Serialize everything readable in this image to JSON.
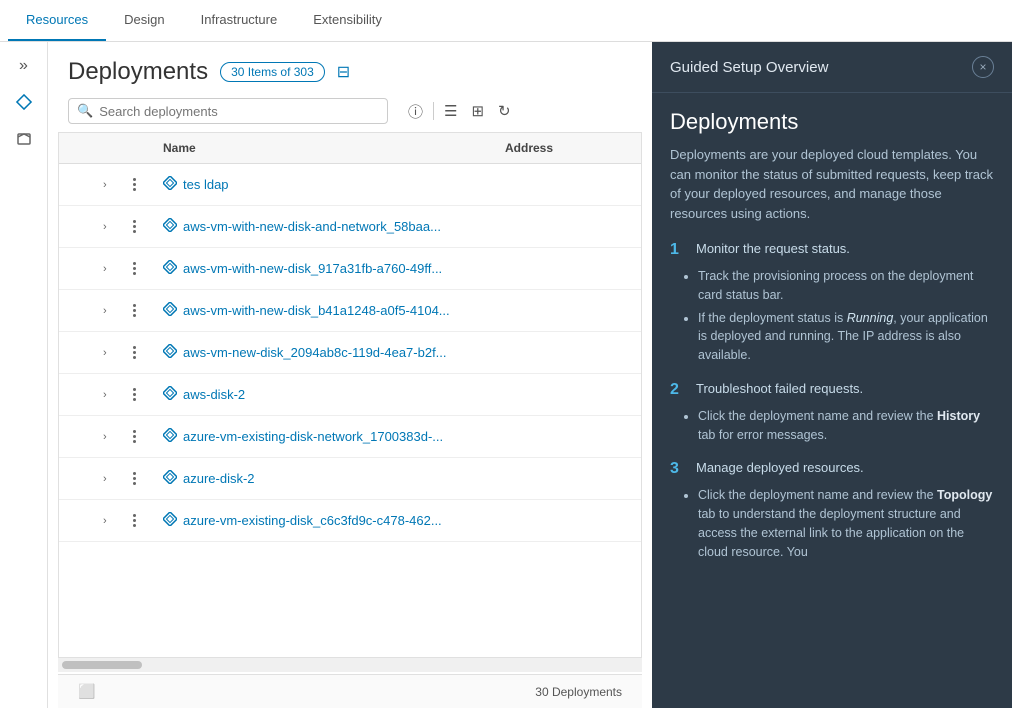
{
  "nav": {
    "tabs": [
      {
        "label": "Resources",
        "active": true
      },
      {
        "label": "Design",
        "active": false
      },
      {
        "label": "Infrastructure",
        "active": false
      },
      {
        "label": "Extensibility",
        "active": false
      }
    ]
  },
  "sidebar": {
    "icons": [
      {
        "name": "chevrons-icon",
        "symbol": "»",
        "active": false
      },
      {
        "name": "diamond-icon",
        "symbol": "◇",
        "active": true
      },
      {
        "name": "cube-icon",
        "symbol": "⬡",
        "active": false
      }
    ]
  },
  "page": {
    "title": "Deployments",
    "badge": "30 Items of 303",
    "search_placeholder": "Search deployments"
  },
  "toolbar": {
    "list_icon": "☰",
    "grid_icon": "⊞",
    "refresh_icon": "↻",
    "info_icon": "ⓘ",
    "filter_icon": "⊟"
  },
  "table": {
    "columns": [
      "Name",
      "Address"
    ],
    "rows": [
      {
        "name": "tes ldap",
        "address": ""
      },
      {
        "name": "aws-vm-with-new-disk-and-network_58baa...",
        "address": ""
      },
      {
        "name": "aws-vm-with-new-disk_917a31fb-a760-49ff...",
        "address": ""
      },
      {
        "name": "aws-vm-with-new-disk_b41a1248-a0f5-4104...",
        "address": ""
      },
      {
        "name": "aws-vm-new-disk_2094ab8c-119d-4ea7-b2f...",
        "address": ""
      },
      {
        "name": "aws-disk-2",
        "address": ""
      },
      {
        "name": "azure-vm-existing-disk-network_1700383d-...",
        "address": ""
      },
      {
        "name": "azure-disk-2",
        "address": ""
      },
      {
        "name": "azure-vm-existing-disk_c6c3fd9c-c478-462...",
        "address": ""
      }
    ],
    "footer": "30 Deployments"
  },
  "guided": {
    "panel_title": "Guided Setup Overview",
    "close_label": "×",
    "section_title": "Deployments",
    "intro": "Deployments are your deployed cloud templates. You can monitor the status of submitted requests, keep track of your deployed resources, and manage those resources using actions.",
    "steps": [
      {
        "number": "1",
        "title": "Monitor the request status.",
        "bullets": [
          "Track the provisioning process on the deployment card status bar.",
          "If the deployment status is Running, your application is deployed and running. The IP address is also available."
        ]
      },
      {
        "number": "2",
        "title": "Troubleshoot failed requests.",
        "bullets": [
          "Click the deployment name and review the <b>History</b> tab for error messages."
        ]
      },
      {
        "number": "3",
        "title": "Manage deployed resources.",
        "bullets": [
          "Click the deployment name and review the <b>Topology</b> tab to understand the deployment structure and access the external link to the application on the cloud resource. You"
        ]
      }
    ]
  }
}
